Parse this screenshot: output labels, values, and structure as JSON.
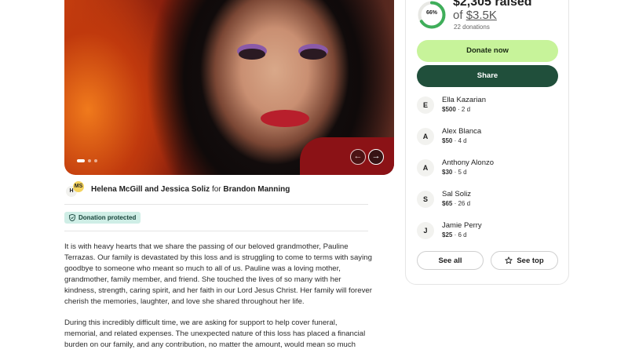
{
  "carousel": {
    "dot_count": 3,
    "active_dot": 0,
    "prev_label": "←",
    "next_label": "→"
  },
  "organizer": {
    "avatar_1": "H",
    "avatar_2": "MS",
    "names": "Helena McGill and Jessica Soliz",
    "connector": "for",
    "beneficiary": "Brandon Manning"
  },
  "badge": {
    "label": "Donation protected"
  },
  "story": {
    "paragraph_1": "It is with heavy hearts that we share the passing of our beloved grandmother, Pauline Terrazas. Our family is devastated by this loss and is struggling to come to terms with saying goodbye to someone who meant so much to all of us. Pauline was a loving mother, grandmother, family member, and friend. She touched the lives of so many with her kindness, strength, caring spirit, and her faith in our Lord Jesus Christ. Her family will forever cherish the memories, laughter, and love she shared throughout her life.",
    "paragraph_2": "During this incredibly difficult time, we are asking for support to help cover funeral, memorial, and related expenses. The unexpected nature of this loss has placed a financial burden on our family, and any contribution, no matter the amount, would mean so much"
  },
  "progress": {
    "percent_label": "66%",
    "fraction": 0.66,
    "raised": "$2,305 raised",
    "goal_prefix": "of",
    "goal": "$3.5K",
    "donations": "22 donations"
  },
  "buttons": {
    "donate": "Donate now",
    "share": "Share",
    "see_all": "See all",
    "see_top": "See top"
  },
  "donors": [
    {
      "initial": "E",
      "name": "Ella Kazarian",
      "amount": "$500",
      "time": "2 d"
    },
    {
      "initial": "A",
      "name": "Alex Blanca",
      "amount": "$50",
      "time": "4 d"
    },
    {
      "initial": "A",
      "name": "Anthony Alonzo",
      "amount": "$30",
      "time": "5 d"
    },
    {
      "initial": "S",
      "name": "Sal Soliz",
      "amount": "$65",
      "time": "26 d"
    },
    {
      "initial": "J",
      "name": "Jamie Perry",
      "amount": "$25",
      "time": "6 d"
    }
  ],
  "colors": {
    "progress_ring": "#3fae5a",
    "ring_track": "#e8e8e4",
    "donate_bg": "#c7f39a",
    "share_bg": "#204f3b",
    "badge_bg": "#cfeee6"
  }
}
